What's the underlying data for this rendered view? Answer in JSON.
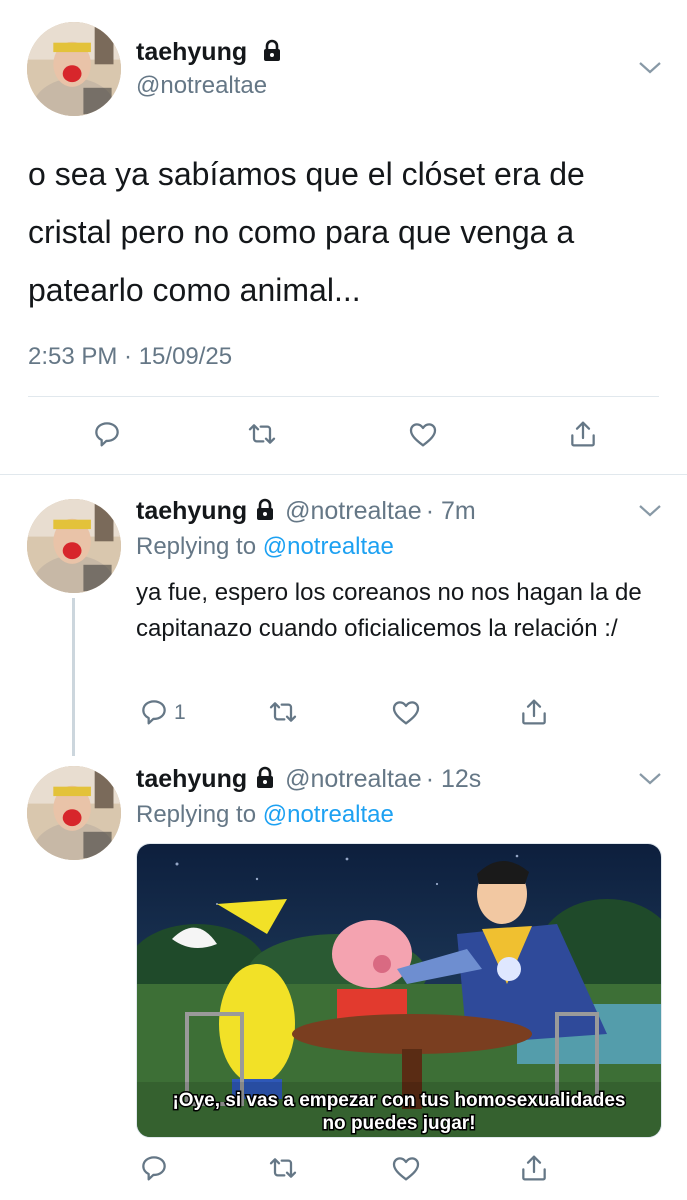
{
  "main_tweet": {
    "display_name": "taehyung",
    "handle": "@notrealtae",
    "text": "o sea ya sabíamos que el clóset era de cristal pero no como para que venga a patearlo como animal...",
    "timestamp": "2:53 PM · 15/09/25"
  },
  "reply1": {
    "display_name": "taehyung",
    "handle": "@notrealtae",
    "time": "· 7m",
    "replying_to_label": "Replying to",
    "replying_to_handle": "@notrealtae",
    "text": "ya fue, espero los coreanos no nos hagan la de capitanazo cuando oficialicemos la relación :/",
    "reply_count": "1"
  },
  "reply2": {
    "display_name": "taehyung",
    "handle": "@notrealtae",
    "time": "· 12s",
    "replying_to_label": "Replying to",
    "replying_to_handle": "@notrealtae",
    "media": {
      "caption_line1": "¡Oye, si vas a empezar con tus homosexualidades",
      "caption_line2": "no puedes jugar!"
    }
  },
  "icons": [
    "reply-icon",
    "retweet-icon",
    "like-icon",
    "share-icon",
    "lock-icon",
    "chevron-down-icon"
  ],
  "colors": {
    "link": "#1da1f2",
    "muted": "#657786",
    "divider": "#e1e8ed"
  }
}
